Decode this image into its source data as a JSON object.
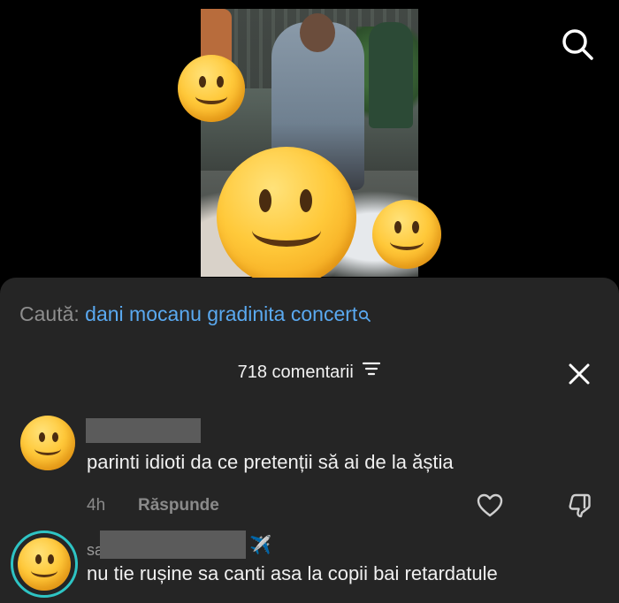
{
  "video": {
    "thumbnail": "concert-video-frame"
  },
  "top_bar": {
    "search_icon": "search-icon"
  },
  "search_suggestion": {
    "prefix": "Caută:",
    "query": "dani mocanu gradinita concert",
    "icon": "search-icon"
  },
  "comments_header": {
    "count_label": "718 comentarii",
    "filter_icon": "filter-icon",
    "close_icon": "close-icon"
  },
  "comments": [
    {
      "avatar": "emoji-avatar",
      "name_prefix": "",
      "text": "parinti idioti da ce pretenții să ai de la ăștia",
      "time": "4h",
      "reply_label": "Răspunde"
    },
    {
      "avatar": "emoji-avatar-with-story-ring",
      "name_prefix": "sa",
      "name_suffix": "✈️",
      "text": "nu tie rușine sa canti asa la copii bai retardatule"
    }
  ],
  "colors": {
    "sheet_background": "#252525",
    "link_blue": "#5aa9f0",
    "muted_text": "#8a8a8a",
    "story_ring": "#2ec4c4"
  }
}
